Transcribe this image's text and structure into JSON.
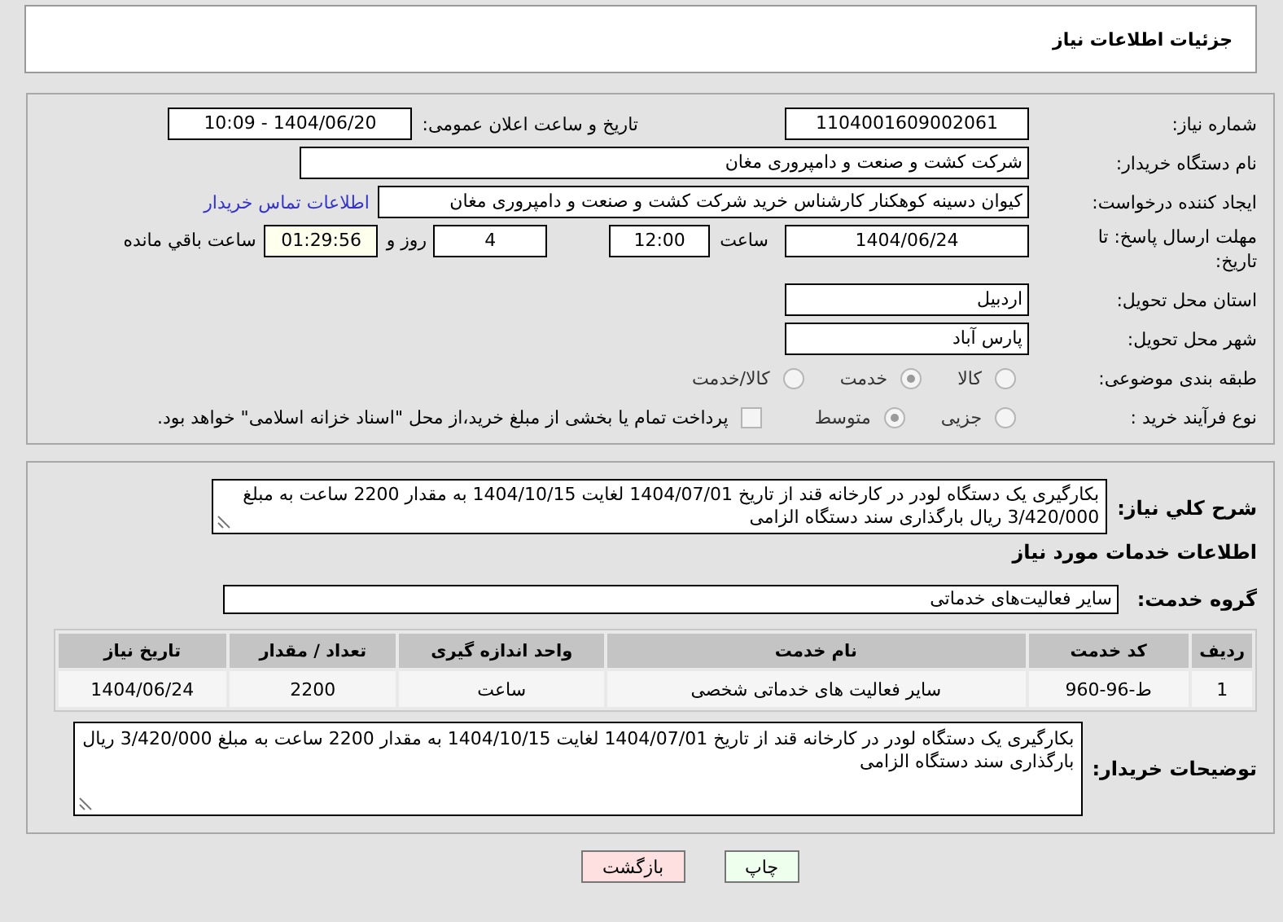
{
  "header": {
    "title": "جزئیات اطلاعات نیاز"
  },
  "need_number": {
    "label": "شماره نیاز:",
    "value": "1104001609002061"
  },
  "announce": {
    "label": "تاریخ و ساعت اعلان عمومی:",
    "value": "1404/06/20 - 10:09"
  },
  "buyer_org": {
    "label": "نام دستگاه خریدار:",
    "value": "شرکت کشت و صنعت و دامپروری مغان"
  },
  "requester": {
    "label": "ایجاد کننده درخواست:",
    "value": "کیوان دسینه کوهکنار کارشناس خرید شرکت کشت و صنعت و دامپروری مغان",
    "link": "اطلاعات تماس خریدار"
  },
  "deadline": {
    "label": "مهلت ارسال پاسخ: تا تاریخ:",
    "date": "1404/06/24",
    "time_label": "ساعت",
    "time": "12:00",
    "days": "4",
    "days_label": "روز و",
    "remaining": "01:29:56",
    "remaining_label": "ساعت باقي مانده"
  },
  "province": {
    "label": "استان محل تحویل:",
    "value": "اردبیل"
  },
  "city": {
    "label": "شهر محل تحویل:",
    "value": "پارس آباد"
  },
  "category": {
    "label": "طبقه بندی موضوعی:",
    "options": [
      {
        "label": "کالا",
        "selected": false
      },
      {
        "label": "خدمت",
        "selected": true
      },
      {
        "label": "کالا/خدمت",
        "selected": false
      }
    ]
  },
  "process": {
    "label": "نوع فرآیند خرید :",
    "options": [
      {
        "label": "جزیی",
        "selected": false
      },
      {
        "label": "متوسط",
        "selected": true
      }
    ],
    "payment": {
      "label": "پرداخت تمام یا بخشی از مبلغ خرید،از محل \"اسناد خزانه اسلامی\" خواهد بود.",
      "checked": false
    }
  },
  "description": {
    "label": "شرح کلي نياز:",
    "value": "بکارگیری یک دستگاه لودر در کارخانه قند از تاریخ 1404/07/01 لغایت 1404/10/15 به مقدار 2200  ساعت به مبلغ 3/420/000  ریال بارگذاری سند دستگاه الزامی"
  },
  "services_heading": "اطلاعات خدمات مورد نياز",
  "service_group": {
    "label": "گروه خدمت:",
    "value": "سایر فعالیت‌های خدماتی"
  },
  "table": {
    "columns": [
      "ردیف",
      "کد خدمت",
      "نام خدمت",
      "واحد اندازه گیری",
      "تعداد / مقدار",
      "تاریخ نیاز"
    ],
    "rows": [
      [
        "1",
        "ط-96-960",
        "سایر فعالیت های خدماتی شخصی",
        "ساعت",
        "2200",
        "1404/06/24"
      ]
    ]
  },
  "buyer_notes": {
    "label": "توضیحات خریدار:",
    "value": "بکارگیری یک دستگاه لودر در کارخانه قند از تاریخ 1404/07/01 لغایت 1404/10/15 به مقدار 2200  ساعت به مبلغ 3/420/000  ریال بارگذاری سند دستگاه الزامی"
  },
  "buttons": [
    {
      "label": "چاپ",
      "kind": "print"
    },
    {
      "label": "بازگشت",
      "kind": "back"
    }
  ]
}
